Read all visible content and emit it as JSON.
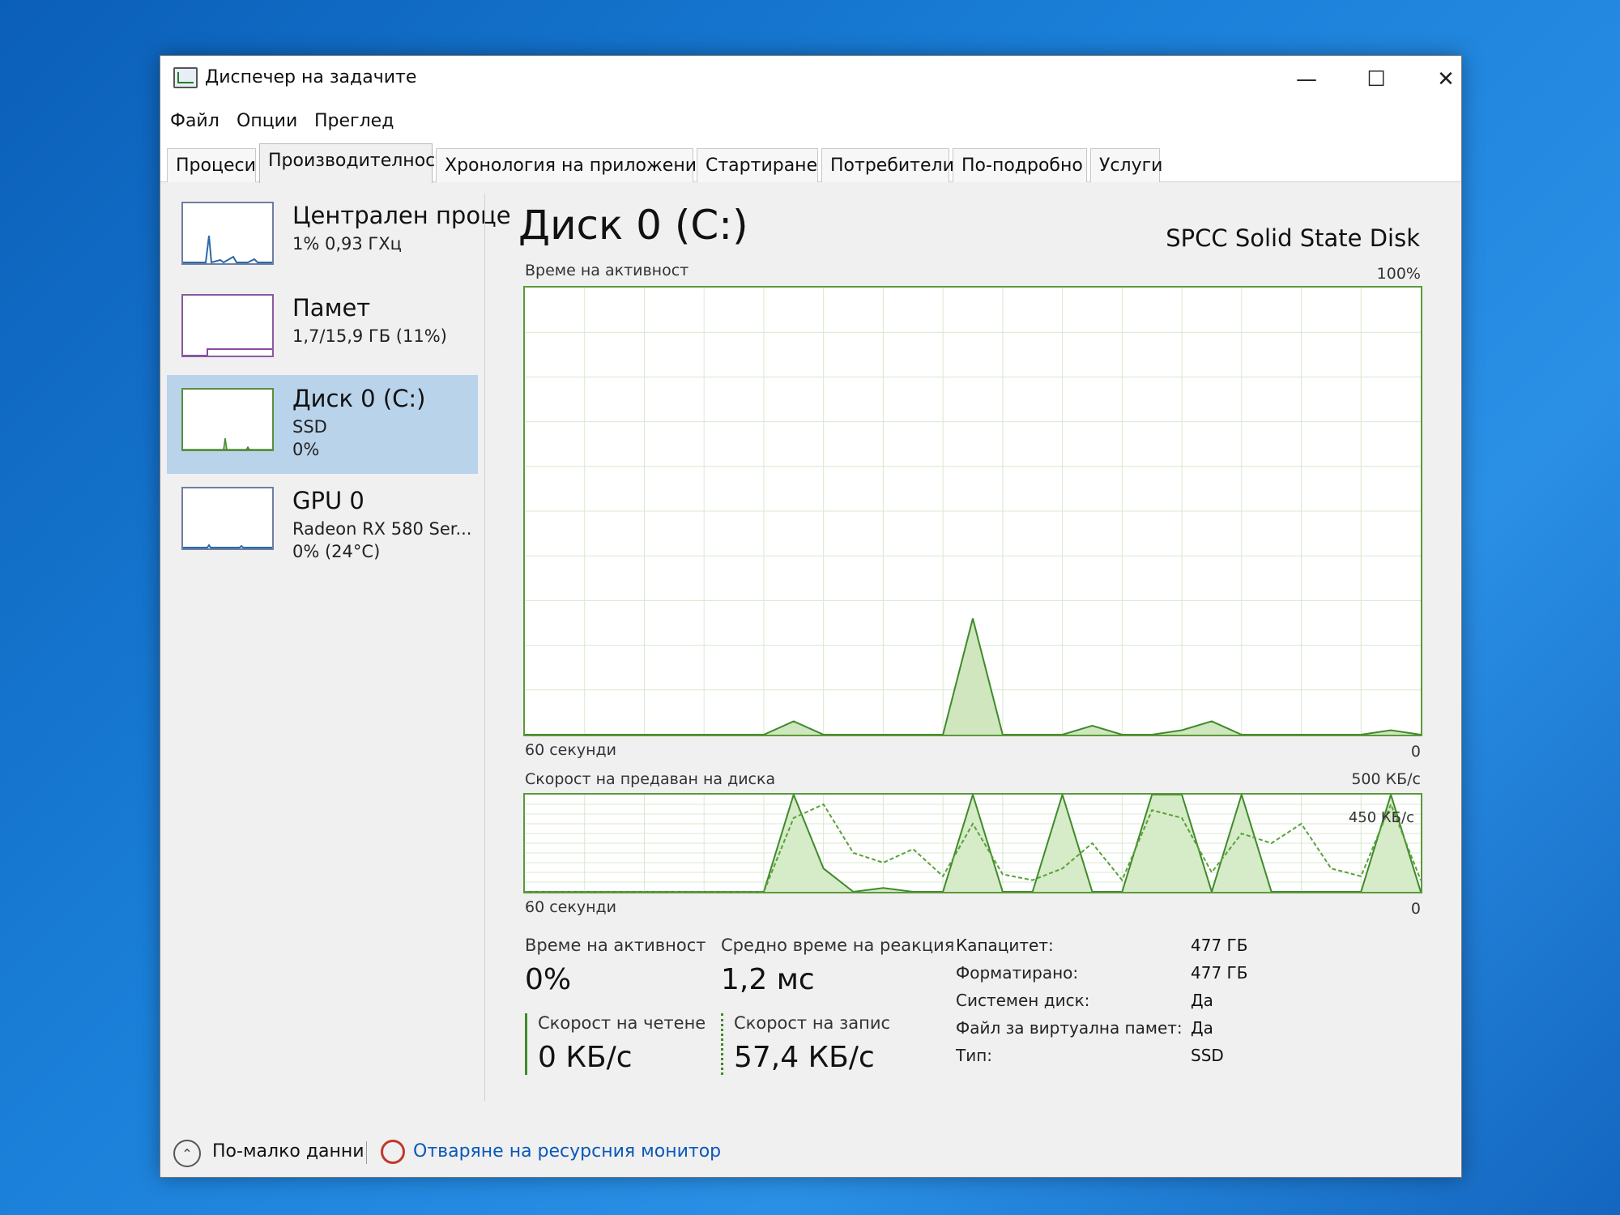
{
  "window": {
    "title": "Диспечер на задачите",
    "controls": {
      "minimize": "—",
      "maximize": "☐",
      "close": "✕"
    }
  },
  "menu": {
    "items": [
      "Файл",
      "Опции",
      "Преглед"
    ]
  },
  "tabs": [
    "Процеси",
    "Производителност",
    "Хронология на приложение",
    "Стартиране",
    "Потребители",
    "По-подробно",
    "Услуги"
  ],
  "active_tab": "Производителност",
  "sidebar": {
    "items": [
      {
        "title": "Централен проце",
        "line1": "1% 0,93 ГХц",
        "line2": ""
      },
      {
        "title": "Памет",
        "line1": "1,7/15,9 ГБ (11%)",
        "line2": ""
      },
      {
        "title": "Диск 0 (C:)",
        "line1": "SSD",
        "line2": "0%"
      },
      {
        "title": "GPU 0",
        "line1": "Radeon RX 580 Ser...",
        "line2": "0% (24°C)"
      }
    ],
    "selected_index": 2
  },
  "main": {
    "title": "Диск 0 (C:)",
    "model": "SPCC Solid State Disk",
    "chart1": {
      "label": "Време на активност",
      "max_label": "100%",
      "x_left": "60 секунди",
      "x_right": "0"
    },
    "chart2": {
      "label": "Скорост на предаван на диска",
      "max_label": "500 КБ/с",
      "inner_label": "450 КБ/с",
      "x_left": "60 секунди",
      "x_right": "0"
    },
    "stats": {
      "active_time_label": "Време на активност",
      "active_time_value": "0%",
      "response_label": "Средно време на реакция",
      "response_value": "1,2 мс",
      "read_label": "Скорост на четене",
      "read_value": "0 КБ/с",
      "write_label": "Скорост на запис",
      "write_value": "57,4 КБ/с"
    },
    "properties": [
      {
        "label": "Капацитет:",
        "value": "477 ГБ"
      },
      {
        "label": "Форматирано:",
        "value": "477 ГБ"
      },
      {
        "label": "Системен диск:",
        "value": "Да"
      },
      {
        "label": "Файл за виртуална памет:",
        "value": "Да"
      },
      {
        "label": "Тип:",
        "value": "SSD"
      }
    ]
  },
  "footer": {
    "fewer_details": "По-малко данни",
    "resource_monitor": "Отваряне на ресурсния монитор"
  },
  "colors": {
    "accent_green": "#5a9a3a",
    "selection": "#b9d3eb",
    "link": "#0a58b8"
  },
  "chart_data": [
    {
      "type": "area",
      "title": "Време на активност",
      "x": [
        60,
        58,
        56,
        54,
        52,
        50,
        48,
        46,
        44,
        42,
        40,
        38,
        36,
        34,
        32,
        30,
        28,
        26,
        24,
        22,
        20,
        18,
        16,
        14,
        12,
        10,
        8,
        6,
        4,
        2,
        0
      ],
      "values": [
        0,
        0,
        0,
        0,
        0,
        0,
        0,
        0,
        0,
        3,
        0,
        0,
        0,
        0,
        0,
        26,
        0,
        0,
        0,
        2,
        0,
        0,
        1,
        3,
        0,
        0,
        0,
        0,
        0,
        1,
        0
      ],
      "ylim": [
        0,
        100
      ],
      "xlabel_left": "60 секунди",
      "xlabel_right": "0"
    },
    {
      "type": "line",
      "title": "Скорост на предаван на диска",
      "x": [
        60,
        58,
        56,
        54,
        52,
        50,
        48,
        46,
        44,
        42,
        40,
        38,
        36,
        34,
        32,
        30,
        28,
        26,
        24,
        22,
        20,
        18,
        16,
        14,
        12,
        10,
        8,
        6,
        4,
        2,
        0
      ],
      "series": [
        {
          "values": [
            0,
            0,
            0,
            0,
            0,
            0,
            0,
            0,
            0,
            500,
            120,
            0,
            20,
            0,
            0,
            500,
            0,
            0,
            500,
            0,
            0,
            500,
            500,
            0,
            500,
            0,
            0,
            0,
            0,
            500,
            0
          ]
        },
        {
          "values": [
            0,
            0,
            0,
            0,
            0,
            0,
            0,
            0,
            0,
            380,
            450,
            200,
            150,
            220,
            80,
            350,
            90,
            60,
            120,
            250,
            60,
            420,
            380,
            100,
            300,
            250,
            350,
            120,
            80,
            450,
            60
          ]
        }
      ],
      "ylim": [
        0,
        500
      ],
      "ylabel_top": "500 КБ/с",
      "annotation": "450 КБ/с",
      "xlabel_left": "60 секунди",
      "xlabel_right": "0"
    }
  ]
}
